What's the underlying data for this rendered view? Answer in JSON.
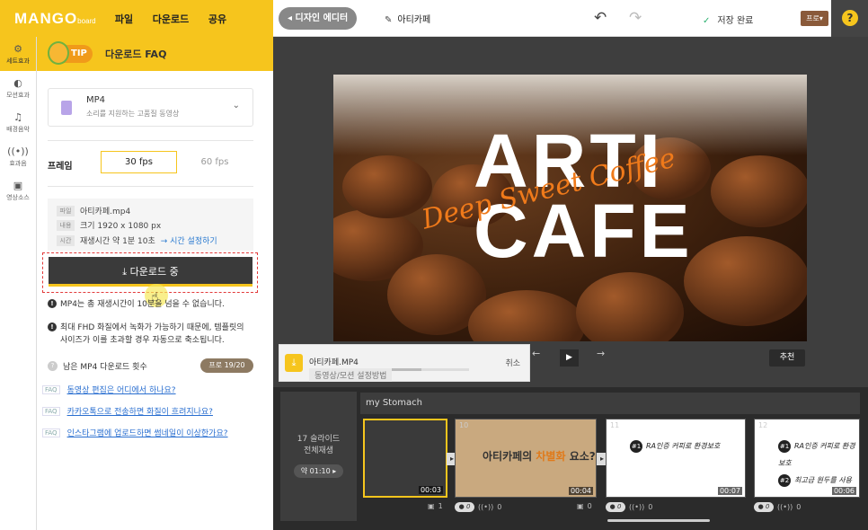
{
  "app": {
    "logo": "MANGO",
    "logo_sub": "board",
    "menu": [
      "파일",
      "다운로드",
      "공유"
    ]
  },
  "topbar": {
    "back_label": "◂ 디자인 에디터",
    "project_name": "아티카페",
    "save_status": "저장 완료",
    "plan_select": "프로",
    "help_icon": "?"
  },
  "sidebar": {
    "items": [
      {
        "label": "세트효과",
        "icon": "settings-icon",
        "active": true
      },
      {
        "label": "모션효과",
        "icon": "motion-icon"
      },
      {
        "label": "배경음악",
        "icon": "music-icon"
      },
      {
        "label": "효과음",
        "icon": "sound-icon"
      },
      {
        "label": "영상소스",
        "icon": "video-source-icon"
      }
    ]
  },
  "panel": {
    "tip_badge": "TIP",
    "title": "다운로드 FAQ",
    "format": {
      "name": "MP4",
      "desc": "소리를 지원하는 고품질 동영상"
    },
    "frame_label": "프레임",
    "fps_options": [
      "30 fps",
      "60 fps"
    ],
    "fps_selected": "30 fps",
    "info": {
      "file_tag": "파일",
      "file_value": "아티카페.mp4",
      "content_tag": "내용",
      "content_value": "크기 1920 x 1080 px",
      "time_tag": "시간",
      "time_value": "재생시간 약 1분 10초",
      "time_link": "→ 시간 설정하기"
    },
    "download_button": "⤓ 다운로드 중",
    "note1": "MP4는 총 재생시간이 10분을 넘을 수 없습니다.",
    "note2": "최대 FHD 화질에서 녹화가 가능하기 때문에, 템플릿의 사이즈가 이를 초과할 경우 자동으로 축소됩니다.",
    "remain_label": "남은 MP4 다운로드 횟수",
    "remain_badge": "프로 19/20",
    "faq_tag": "FAQ",
    "faqs": [
      "동영상 편집은 어디에서 하나요?",
      "카카오톡으로 전송하면 화질이 흐려지나요?",
      "인스타그램에 업로드하면 썸네일이 이상한가요?"
    ]
  },
  "slide": {
    "line1": "ARTI",
    "line2": "CAFE",
    "script": "Deep Sweet Coffee"
  },
  "toast": {
    "file": "아티카페.MP4",
    "cancel": "취소",
    "hint": "동영상/모션 설정방법",
    "progress": 0.7
  },
  "controls": {
    "prev": "←",
    "play": "▶",
    "next": "→",
    "recommend": "추천"
  },
  "timeline": {
    "track_name": "my Stomach",
    "total_slides": "17 슬라이드",
    "play_all": "전체재생",
    "duration": "약 01:10 ▸",
    "thumbs": [
      {
        "num": "",
        "time": "00:03",
        "caption": ""
      },
      {
        "num": "10",
        "time": "00:04",
        "caption_a": "아티카페의 ",
        "caption_b": "차별화",
        "caption_c": " 요소?"
      },
      {
        "num": "11",
        "time": "00:07",
        "items": [
          "RA인증 커피로 환경보호"
        ]
      },
      {
        "num": "12",
        "time": "00:06",
        "items": [
          "RA인증 커피로 환경보호",
          "최고급 원두를 사용"
        ]
      }
    ],
    "row_labels": [
      "1",
      "0",
      "0",
      "0",
      "0",
      "0",
      "0",
      "0"
    ]
  }
}
